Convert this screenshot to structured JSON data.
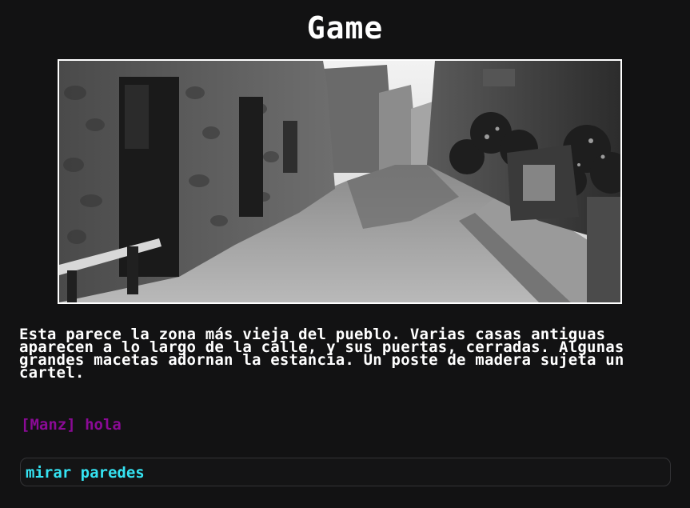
{
  "header": {
    "title": "Game"
  },
  "scene": {
    "image_subject": "black-and-white photo of an old stone village street with houses, closed doors, plant pots and a wooden bench"
  },
  "narration": {
    "text": "Esta parece la zona más vieja del pueblo. Varias casas antiguas aparecen a lo largo de la calle, y sus puertas, cerradas. Algunas grandes macetas adornan la estancia. Un poste de madera sujeta un cartel."
  },
  "chat": {
    "user": "[Manz]",
    "message": "hola"
  },
  "command": {
    "value": "mirar paredes"
  },
  "colors": {
    "background": "#121213",
    "title": "#ffffff",
    "narration": "#ffffff",
    "chat": "#8b0a96",
    "input_text": "#35e3f2",
    "input_border": "#333336"
  }
}
